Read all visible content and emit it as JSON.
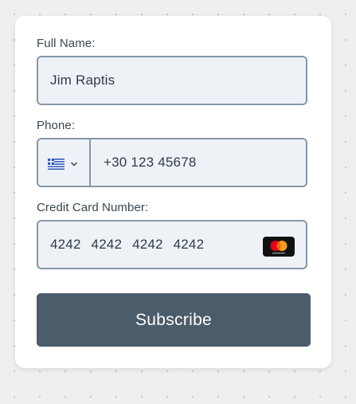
{
  "form": {
    "full_name": {
      "label": "Full Name:",
      "value": "Jim Raptis"
    },
    "phone": {
      "label": "Phone:",
      "country_flag": "greece-flag-icon",
      "value": "+30 123 45678"
    },
    "credit_card": {
      "label": "Credit Card Number:",
      "value": "4242 4242 4242 4242",
      "brand": "mastercard-icon"
    },
    "submit_label": "Subscribe"
  },
  "colors": {
    "button_bg": "#4b5c6b",
    "field_bg": "#eef2f7",
    "field_border": "#8597a9",
    "page_bg": "#eeeff1"
  }
}
